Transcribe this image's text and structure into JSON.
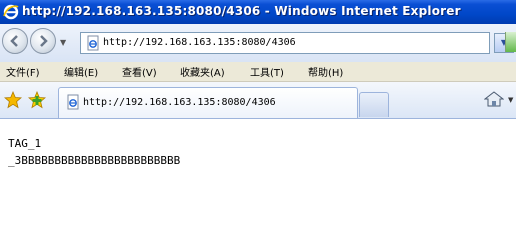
{
  "window": {
    "title": "http://192.168.163.135:8080/4306 - Windows Internet Explorer",
    "icon": "ie-logo-icon"
  },
  "navigation": {
    "back_icon": "back-arrow-icon",
    "forward_icon": "forward-arrow-icon",
    "address": "http://192.168.163.135:8080/4306",
    "address_icon": "page-icon"
  },
  "menu": {
    "items": [
      {
        "label": "文件(F)"
      },
      {
        "label": "编辑(E)"
      },
      {
        "label": "查看(V)"
      },
      {
        "label": "收藏夹(A)"
      },
      {
        "label": "工具(T)"
      },
      {
        "label": "帮助(H)"
      }
    ]
  },
  "tabs": {
    "active_label": "http://192.168.163.135:8080/4306",
    "colors": {
      "star": "#f5b800",
      "add": "#3ca02a"
    }
  },
  "content": {
    "line1": "TAG_1",
    "line2": "_3BBBBBBBBBBBBBBBBBBBBBBBB"
  }
}
